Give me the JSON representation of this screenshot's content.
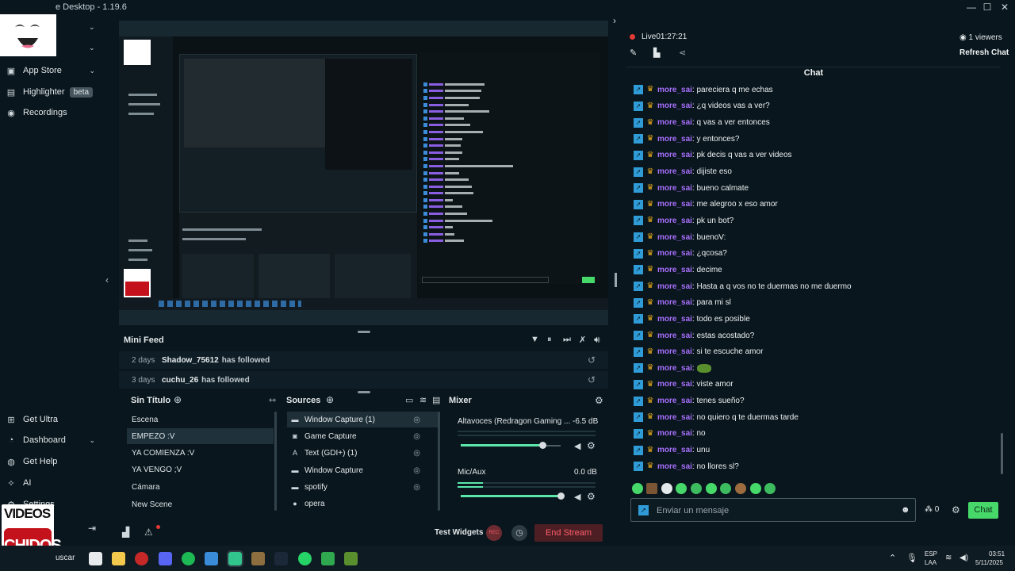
{
  "window": {
    "title": "e Desktop - 1.19.6",
    "minimize": "—",
    "maximize": "☐",
    "close": "✕"
  },
  "sidebar": {
    "items": [
      {
        "label": "App Store"
      },
      {
        "label": "Highlighter",
        "badge": "beta"
      },
      {
        "label": "Recordings"
      },
      {
        "label": "Get Ultra"
      },
      {
        "label": "Dashboard"
      },
      {
        "label": "Get Help"
      },
      {
        "label": "AI"
      },
      {
        "label": "Settings"
      }
    ],
    "logo_top": "VIDEOS",
    "logo_bottom": "CHIDOS"
  },
  "mini_feed": {
    "title": "Mini Feed",
    "events": [
      {
        "time": "2 days",
        "user": "Shadow_75612",
        "action": "has followed"
      },
      {
        "time": "3 days",
        "user": "cuchu_26",
        "action": "has followed"
      }
    ]
  },
  "scenes": {
    "title": "Sin Título",
    "items": [
      "Escena",
      "EMPEZO :V",
      "YA COMIENZA :V",
      "YA VENGO ;V",
      "Cámara",
      "New Scene"
    ],
    "active_index": 1
  },
  "sources": {
    "title": "Sources",
    "items": [
      {
        "label": "Window Capture (1)",
        "icon": "window-icon"
      },
      {
        "label": "Game Capture",
        "icon": "gamepad-icon"
      },
      {
        "label": "Text (GDI+) (1)",
        "icon": "text-icon"
      },
      {
        "label": "Window Capture",
        "icon": "window-icon"
      },
      {
        "label": "spotify",
        "icon": "window-icon"
      },
      {
        "label": "opera",
        "icon": "user-icon"
      }
    ]
  },
  "mixer": {
    "title": "Mixer",
    "channels": [
      {
        "name": "Altavoces (Redragon Gaming ...",
        "db": "-6.5 dB",
        "volume": 0.82
      },
      {
        "name": "Mic/Aux",
        "db": "0.0 dB",
        "volume": 1.0
      }
    ]
  },
  "bottom": {
    "test_widgets": "Test Widgets",
    "rec": "REC",
    "end_stream": "End Stream"
  },
  "chat": {
    "live_label": "Live",
    "live_time": "01:27:21",
    "viewers": "1 viewers",
    "refresh": "Refresh Chat",
    "header": "Chat",
    "messages": [
      {
        "user": "more_sai",
        "text": ": pareciera q me echas"
      },
      {
        "user": "more_sai",
        "text": ": ¿q videos vas a ver?"
      },
      {
        "user": "more_sai",
        "text": ": q vas a ver entonces"
      },
      {
        "user": "more_sai",
        "text": ": y entonces?"
      },
      {
        "user": "more_sai",
        "text": ": pk decis q vas a ver videos"
      },
      {
        "user": "more_sai",
        "text": ": dijiste eso"
      },
      {
        "user": "more_sai",
        "text": ": bueno calmate"
      },
      {
        "user": "more_sai",
        "text": ": me alegroo x eso amor"
      },
      {
        "user": "more_sai",
        "text": ": pk un bot?"
      },
      {
        "user": "more_sai",
        "text": ": buenoV:"
      },
      {
        "user": "more_sai",
        "text": ": ¿qcosa?"
      },
      {
        "user": "more_sai",
        "text": ": decime"
      },
      {
        "user": "more_sai",
        "text": ": Hasta a q vos no te duermas no me duermo"
      },
      {
        "user": "more_sai",
        "text": ": para mi sl"
      },
      {
        "user": "more_sai",
        "text": ": todo es posible"
      },
      {
        "user": "more_sai",
        "text": ": estas acostado?"
      },
      {
        "user": "more_sai",
        "text": ": si te escuche amor"
      },
      {
        "user": "more_sai",
        "text": ":"
      },
      {
        "user": "more_sai",
        "text": ": viste amor"
      },
      {
        "user": "more_sai",
        "text": ": tenes sueño?"
      },
      {
        "user": "more_sai",
        "text": ": no quiero q te duermas tarde"
      },
      {
        "user": "more_sai",
        "text": ": no"
      },
      {
        "user": "more_sai",
        "text": ": unu"
      },
      {
        "user": "more_sai",
        "text": ": no llores sl?"
      }
    ],
    "input_placeholder": "Enviar un mensaje",
    "points": "0",
    "send": "Chat"
  },
  "taskbar": {
    "search": "uscar",
    "lang": "ESP",
    "lang2": "LAA",
    "time": "03:51",
    "date": "5/11/2025"
  },
  "colors": {
    "accent": "#46d96a",
    "username": "#a970ff",
    "live": "#e53935"
  }
}
